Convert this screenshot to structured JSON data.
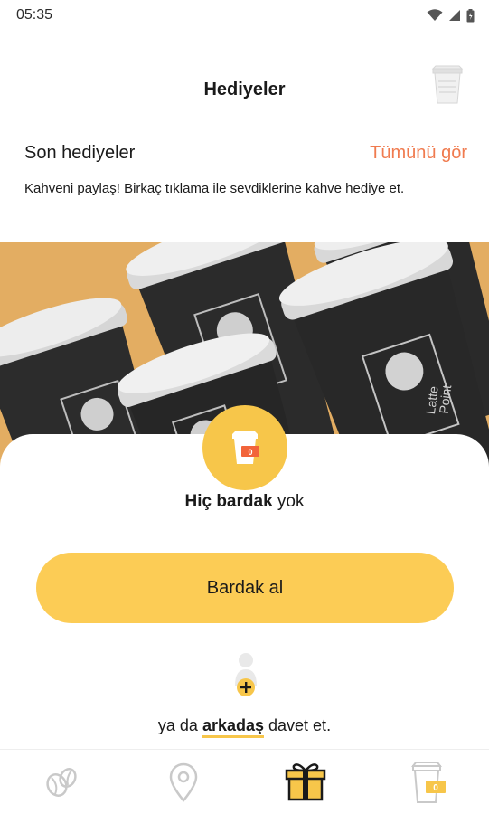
{
  "status_bar": {
    "time": "05:35",
    "icons": [
      "wifi-icon",
      "signal-icon",
      "battery-icon"
    ]
  },
  "header": {
    "title": "Hediyeler",
    "cup_icon": "cup-icon"
  },
  "section": {
    "title": "Son hediyeler",
    "see_all": "Tümünü gör",
    "subtitle": "Kahveni paylaş! Birkaç tıklama ile sevdiklerine kahve hediye et."
  },
  "hero": {
    "cup_brand_line1": "Latte",
    "cup_brand_line2": "Point"
  },
  "empty_state": {
    "badge_count": "0",
    "bold": "Hiç bardak",
    "rest": " yok"
  },
  "buy_button": "Bardak al",
  "invite": {
    "prefix": "ya da ",
    "link": "arkadaş",
    "suffix": " davet et."
  },
  "bottom_nav": {
    "items": [
      {
        "icon": "coffee-beans-icon",
        "active": false
      },
      {
        "icon": "location-pin-icon",
        "active": false
      },
      {
        "icon": "gift-icon",
        "active": true
      },
      {
        "icon": "cup-badge-icon",
        "active": false,
        "badge": "0"
      }
    ]
  },
  "colors": {
    "accent_yellow": "#fccc55",
    "badge_yellow": "#f7c64a",
    "link_orange": "#f07b4f",
    "hero_background": "#e3ad62",
    "cup_dark": "#2a2a2a",
    "badge_red": "#f2643a"
  }
}
